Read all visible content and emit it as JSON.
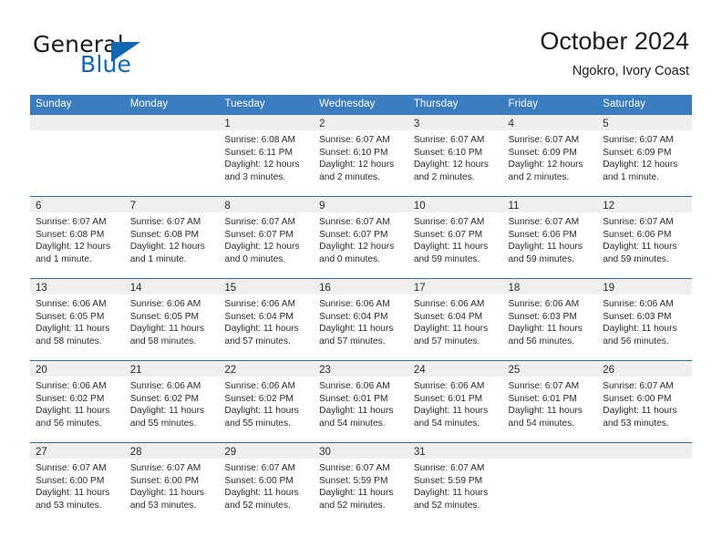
{
  "brand": {
    "name_line1": "General",
    "name_line2": "Blue",
    "accent_color": "#1267b3",
    "logo_icon": "triangle-icon"
  },
  "header": {
    "title": "October 2024",
    "subtitle": "Ngokro, Ivory Coast"
  },
  "calendar": {
    "header_color": "#3b7dbf",
    "weekdays": [
      "Sunday",
      "Monday",
      "Tuesday",
      "Wednesday",
      "Thursday",
      "Friday",
      "Saturday"
    ],
    "weeks": [
      [
        {
          "day": "",
          "lines": []
        },
        {
          "day": "",
          "lines": []
        },
        {
          "day": "1",
          "lines": [
            "Sunrise: 6:08 AM",
            "Sunset: 6:11 PM",
            "Daylight: 12 hours",
            "and 3 minutes."
          ]
        },
        {
          "day": "2",
          "lines": [
            "Sunrise: 6:07 AM",
            "Sunset: 6:10 PM",
            "Daylight: 12 hours",
            "and 2 minutes."
          ]
        },
        {
          "day": "3",
          "lines": [
            "Sunrise: 6:07 AM",
            "Sunset: 6:10 PM",
            "Daylight: 12 hours",
            "and 2 minutes."
          ]
        },
        {
          "day": "4",
          "lines": [
            "Sunrise: 6:07 AM",
            "Sunset: 6:09 PM",
            "Daylight: 12 hours",
            "and 2 minutes."
          ]
        },
        {
          "day": "5",
          "lines": [
            "Sunrise: 6:07 AM",
            "Sunset: 6:09 PM",
            "Daylight: 12 hours",
            "and 1 minute."
          ]
        }
      ],
      [
        {
          "day": "6",
          "lines": [
            "Sunrise: 6:07 AM",
            "Sunset: 6:08 PM",
            "Daylight: 12 hours",
            "and 1 minute."
          ]
        },
        {
          "day": "7",
          "lines": [
            "Sunrise: 6:07 AM",
            "Sunset: 6:08 PM",
            "Daylight: 12 hours",
            "and 1 minute."
          ]
        },
        {
          "day": "8",
          "lines": [
            "Sunrise: 6:07 AM",
            "Sunset: 6:07 PM",
            "Daylight: 12 hours",
            "and 0 minutes."
          ]
        },
        {
          "day": "9",
          "lines": [
            "Sunrise: 6:07 AM",
            "Sunset: 6:07 PM",
            "Daylight: 12 hours",
            "and 0 minutes."
          ]
        },
        {
          "day": "10",
          "lines": [
            "Sunrise: 6:07 AM",
            "Sunset: 6:07 PM",
            "Daylight: 11 hours",
            "and 59 minutes."
          ]
        },
        {
          "day": "11",
          "lines": [
            "Sunrise: 6:07 AM",
            "Sunset: 6:06 PM",
            "Daylight: 11 hours",
            "and 59 minutes."
          ]
        },
        {
          "day": "12",
          "lines": [
            "Sunrise: 6:07 AM",
            "Sunset: 6:06 PM",
            "Daylight: 11 hours",
            "and 59 minutes."
          ]
        }
      ],
      [
        {
          "day": "13",
          "lines": [
            "Sunrise: 6:06 AM",
            "Sunset: 6:05 PM",
            "Daylight: 11 hours",
            "and 58 minutes."
          ]
        },
        {
          "day": "14",
          "lines": [
            "Sunrise: 6:06 AM",
            "Sunset: 6:05 PM",
            "Daylight: 11 hours",
            "and 58 minutes."
          ]
        },
        {
          "day": "15",
          "lines": [
            "Sunrise: 6:06 AM",
            "Sunset: 6:04 PM",
            "Daylight: 11 hours",
            "and 57 minutes."
          ]
        },
        {
          "day": "16",
          "lines": [
            "Sunrise: 6:06 AM",
            "Sunset: 6:04 PM",
            "Daylight: 11 hours",
            "and 57 minutes."
          ]
        },
        {
          "day": "17",
          "lines": [
            "Sunrise: 6:06 AM",
            "Sunset: 6:04 PM",
            "Daylight: 11 hours",
            "and 57 minutes."
          ]
        },
        {
          "day": "18",
          "lines": [
            "Sunrise: 6:06 AM",
            "Sunset: 6:03 PM",
            "Daylight: 11 hours",
            "and 56 minutes."
          ]
        },
        {
          "day": "19",
          "lines": [
            "Sunrise: 6:06 AM",
            "Sunset: 6:03 PM",
            "Daylight: 11 hours",
            "and 56 minutes."
          ]
        }
      ],
      [
        {
          "day": "20",
          "lines": [
            "Sunrise: 6:06 AM",
            "Sunset: 6:02 PM",
            "Daylight: 11 hours",
            "and 56 minutes."
          ]
        },
        {
          "day": "21",
          "lines": [
            "Sunrise: 6:06 AM",
            "Sunset: 6:02 PM",
            "Daylight: 11 hours",
            "and 55 minutes."
          ]
        },
        {
          "day": "22",
          "lines": [
            "Sunrise: 6:06 AM",
            "Sunset: 6:02 PM",
            "Daylight: 11 hours",
            "and 55 minutes."
          ]
        },
        {
          "day": "23",
          "lines": [
            "Sunrise: 6:06 AM",
            "Sunset: 6:01 PM",
            "Daylight: 11 hours",
            "and 54 minutes."
          ]
        },
        {
          "day": "24",
          "lines": [
            "Sunrise: 6:06 AM",
            "Sunset: 6:01 PM",
            "Daylight: 11 hours",
            "and 54 minutes."
          ]
        },
        {
          "day": "25",
          "lines": [
            "Sunrise: 6:07 AM",
            "Sunset: 6:01 PM",
            "Daylight: 11 hours",
            "and 54 minutes."
          ]
        },
        {
          "day": "26",
          "lines": [
            "Sunrise: 6:07 AM",
            "Sunset: 6:00 PM",
            "Daylight: 11 hours",
            "and 53 minutes."
          ]
        }
      ],
      [
        {
          "day": "27",
          "lines": [
            "Sunrise: 6:07 AM",
            "Sunset: 6:00 PM",
            "Daylight: 11 hours",
            "and 53 minutes."
          ]
        },
        {
          "day": "28",
          "lines": [
            "Sunrise: 6:07 AM",
            "Sunset: 6:00 PM",
            "Daylight: 11 hours",
            "and 53 minutes."
          ]
        },
        {
          "day": "29",
          "lines": [
            "Sunrise: 6:07 AM",
            "Sunset: 6:00 PM",
            "Daylight: 11 hours",
            "and 52 minutes."
          ]
        },
        {
          "day": "30",
          "lines": [
            "Sunrise: 6:07 AM",
            "Sunset: 5:59 PM",
            "Daylight: 11 hours",
            "and 52 minutes."
          ]
        },
        {
          "day": "31",
          "lines": [
            "Sunrise: 6:07 AM",
            "Sunset: 5:59 PM",
            "Daylight: 11 hours",
            "and 52 minutes."
          ]
        },
        {
          "day": "",
          "lines": []
        },
        {
          "day": "",
          "lines": []
        }
      ]
    ]
  }
}
